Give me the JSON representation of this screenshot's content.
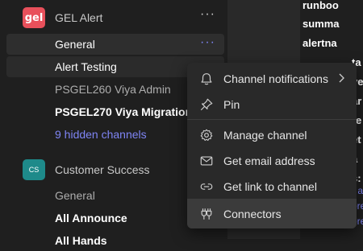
{
  "teams": [
    {
      "name": "GEL Alert",
      "avatar_text": "gel",
      "avatar_color": "#e8505b",
      "more": "···"
    },
    {
      "name": "Customer Success",
      "avatar_text": "CS",
      "avatar_color": "#1e8a8a"
    }
  ],
  "gel_channels": [
    {
      "label": "General",
      "more": "···"
    },
    {
      "label": "Alert Testing"
    },
    {
      "label": "PSGEL260 Viya Admin"
    },
    {
      "label": "PSGEL270 Viya Migration"
    },
    {
      "label": "9 hidden channels"
    }
  ],
  "cs_channels": [
    {
      "label": "General"
    },
    {
      "label": "All Announce"
    },
    {
      "label": "All Hands"
    }
  ],
  "context_menu": {
    "items": [
      {
        "label": "Channel notifications",
        "icon": "bell-icon"
      },
      {
        "label": "Pin",
        "icon": "pin-icon"
      },
      {
        "label": "Manage channel",
        "icon": "gear-icon"
      },
      {
        "label": "Get email address",
        "icon": "mail-icon"
      },
      {
        "label": "Get link to channel",
        "icon": "link-icon"
      },
      {
        "label": "Connectors",
        "icon": "connector-icon"
      }
    ]
  },
  "right_pane": {
    "lines": [
      "runboo",
      "summa",
      "alertna"
    ],
    "fragments": [
      "ta",
      "ve",
      "ar",
      "re",
      "et",
      "a",
      "s:"
    ],
    "links": [
      "r a",
      "ore",
      "ore"
    ]
  },
  "colors": {
    "accent": "#7f85f5",
    "background": "#1f1f1f",
    "menu_bg": "#292929"
  }
}
